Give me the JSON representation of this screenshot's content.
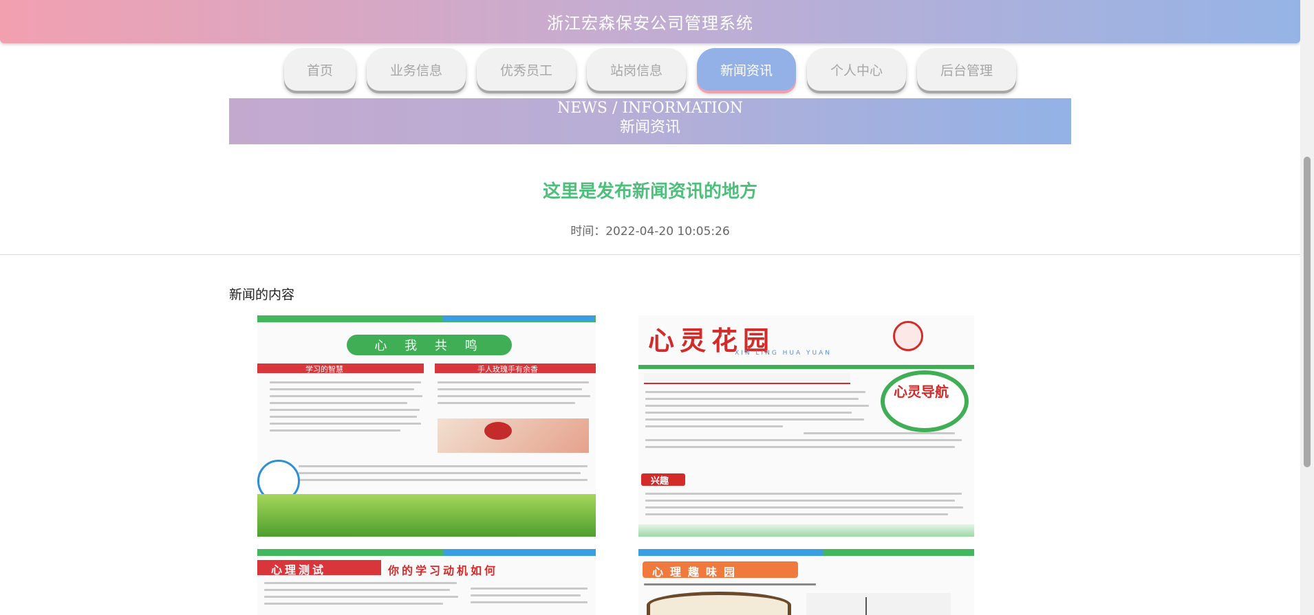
{
  "header": {
    "title": "浙江宏森保安公司管理系统"
  },
  "nav": {
    "items": [
      {
        "label": "首页",
        "active": false
      },
      {
        "label": "业务信息",
        "active": false
      },
      {
        "label": "优秀员工",
        "active": false
      },
      {
        "label": "站岗信息",
        "active": false
      },
      {
        "label": "新闻资讯",
        "active": true
      },
      {
        "label": "个人中心",
        "active": false
      },
      {
        "label": "后台管理",
        "active": false
      }
    ]
  },
  "banner": {
    "en": "NEWS / INFORMATION",
    "cn": "新闻资讯"
  },
  "article": {
    "title": "这里是发布新闻资讯的地方",
    "time": "时间：2022-04-20 10:05:26",
    "content_label": "新闻的内容"
  },
  "posters": {
    "p1": {
      "heading": "心 我 共 鸣",
      "section_a": "学习的智慧",
      "section_b": "手人玫瑰手有余香"
    },
    "p2": {
      "heading": "心灵花园",
      "subtitle": "XIN LING HUA YUAN",
      "tag": "心灵导航",
      "section": "兴趣"
    },
    "p3": {
      "heading": "心理测试",
      "subheading": "你的学习动机如何"
    },
    "p4": {
      "heading": "心理趣味园"
    }
  },
  "colors": {
    "accent_blue": "#93b1e6",
    "accent_pink": "#f2a0b0",
    "title_green": "#4cbf7a"
  }
}
